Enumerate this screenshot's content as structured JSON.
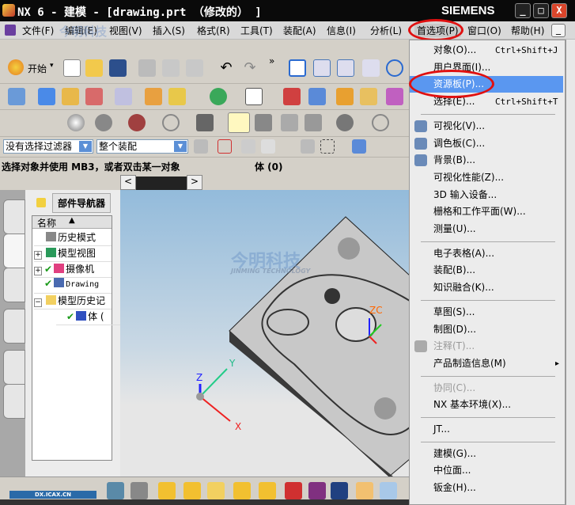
{
  "window": {
    "title": "NX 6 - 建模 - [drawing.prt （修改的） ]",
    "brand": "SIEMENS",
    "minimize": "_",
    "maximize": "□",
    "close": "X"
  },
  "menubar": {
    "items": [
      "文件(F)",
      "编辑(E)",
      "视图(V)",
      "插入(S)",
      "格式(R)",
      "工具(T)",
      "装配(A)",
      "信息(I)",
      "分析(L)",
      "首选项(P)",
      "窗口(O)",
      "帮助(H)"
    ],
    "restore": "_"
  },
  "watermark": {
    "cn": "今明科技",
    "en": "JINMING TECHNOLOGY",
    "site": "DX.ICAX.CN"
  },
  "toolbar": {
    "start_label": "开始",
    "start_caret": "▾",
    "more": "»"
  },
  "filters": {
    "selection_filter": "没有选择过滤器",
    "scope": "整个装配"
  },
  "status": {
    "prompt": "选择对象并使用 MB3，或者双击某一对象",
    "selection": "体 (0)"
  },
  "navigator": {
    "title": "部件导航器",
    "column": "名称",
    "sort_icon": "▲",
    "items": [
      {
        "label": "历史模式",
        "expander": ""
      },
      {
        "label": "模型视图",
        "expander": "+"
      },
      {
        "label": "摄像机",
        "expander": "+"
      },
      {
        "label": "Drawing",
        "expander": ""
      },
      {
        "label": "模型历史记",
        "expander": "−"
      },
      {
        "label": "体 (",
        "expander": ""
      }
    ]
  },
  "viewport": {
    "wcs": {
      "x": "X",
      "y": "Y",
      "z": "Z"
    },
    "zc": "ZC"
  },
  "preferences_menu": {
    "groups": [
      [
        {
          "label": "对象(O)...",
          "shortcut": "Ctrl+Shift+J"
        },
        {
          "label": "用户界面(I)..."
        },
        {
          "label": "资源板(P)...",
          "selected": true
        },
        {
          "label": "选择(E)...",
          "shortcut": "Ctrl+Shift+T"
        }
      ],
      [
        {
          "label": "可视化(V)...",
          "icon": "visualization-icon"
        },
        {
          "label": "调色板(C)...",
          "icon": "palette-icon"
        },
        {
          "label": "背景(B)...",
          "icon": "background-icon"
        },
        {
          "label": "可视化性能(Z)..."
        },
        {
          "label": "3D 输入设备..."
        },
        {
          "label": "栅格和工作平面(W)..."
        },
        {
          "label": "测量(U)..."
        }
      ],
      [
        {
          "label": "电子表格(A)..."
        },
        {
          "label": "装配(B)..."
        },
        {
          "label": "知识融合(K)..."
        }
      ],
      [
        {
          "label": "草图(S)..."
        },
        {
          "label": "制图(D)..."
        },
        {
          "label": "注释(T)...",
          "disabled": true,
          "icon": "annotation-icon"
        },
        {
          "label": "产品制造信息(M)",
          "submenu": "▸"
        }
      ],
      [
        {
          "label": "协同(C)...",
          "disabled": true
        },
        {
          "label": "NX 基本环境(X)..."
        }
      ],
      [
        {
          "label": "JT..."
        }
      ],
      [
        {
          "label": "建模(G)..."
        },
        {
          "label": "中位面..."
        },
        {
          "label": "钣金(H)..."
        }
      ]
    ]
  },
  "colors": {
    "highlight": "#5a97f0",
    "annotation_circle": "#e01010"
  }
}
